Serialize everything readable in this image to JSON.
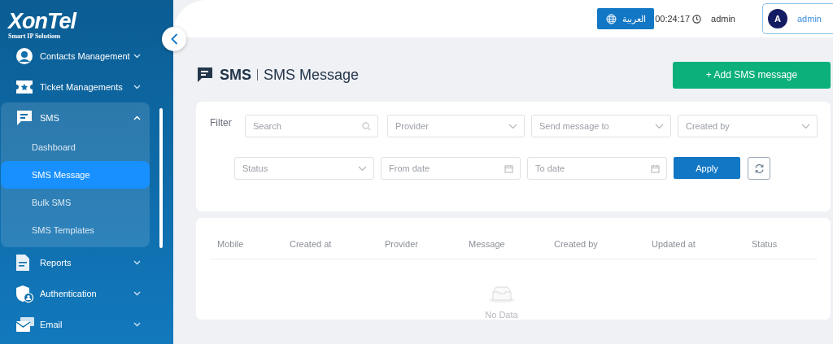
{
  "logo": {
    "name": "XonTel",
    "tagline": "Smart IP Solutions"
  },
  "sidebar": {
    "items": [
      {
        "label": "Contacts Management",
        "kind": "contacts",
        "expanded": false
      },
      {
        "label": "Ticket Managements",
        "kind": "ticket",
        "expanded": false
      },
      {
        "label": "SMS",
        "kind": "sms",
        "expanded": true,
        "children": [
          {
            "label": "Dashboard",
            "selected": false
          },
          {
            "label": "SMS Message",
            "selected": true
          },
          {
            "label": "Bulk SMS",
            "selected": false
          },
          {
            "label": "SMS Templates",
            "selected": false
          }
        ]
      },
      {
        "label": "Reports",
        "kind": "report",
        "expanded": false
      },
      {
        "label": "Authentication",
        "kind": "auth",
        "expanded": false
      },
      {
        "label": "Email",
        "kind": "email",
        "expanded": false
      }
    ]
  },
  "topbar": {
    "language_button": "العربية",
    "timer": "00:24:17",
    "username": "admin",
    "user_menu": {
      "avatar_letter": "A",
      "name": "admin"
    }
  },
  "page": {
    "section": "SMS",
    "title": "SMS Message",
    "add_button": "+ Add SMS message"
  },
  "filter": {
    "label": "Filter",
    "rows": [
      [
        {
          "placeholder": "Search",
          "kind": "search"
        },
        {
          "placeholder": "Provider",
          "kind": "select"
        },
        {
          "placeholder": "Send message to",
          "kind": "select"
        },
        {
          "placeholder": "Created by",
          "kind": "select"
        }
      ],
      [
        {
          "placeholder": "Status",
          "kind": "select"
        },
        {
          "placeholder": "From date",
          "kind": "date"
        },
        {
          "placeholder": "To date",
          "kind": "date"
        }
      ]
    ],
    "apply_button": "Apply"
  },
  "table": {
    "columns": [
      "Mobile",
      "Created at",
      "Provider",
      "Message",
      "Created by",
      "Updated at",
      "Status"
    ],
    "empty_text": "No Data"
  }
}
